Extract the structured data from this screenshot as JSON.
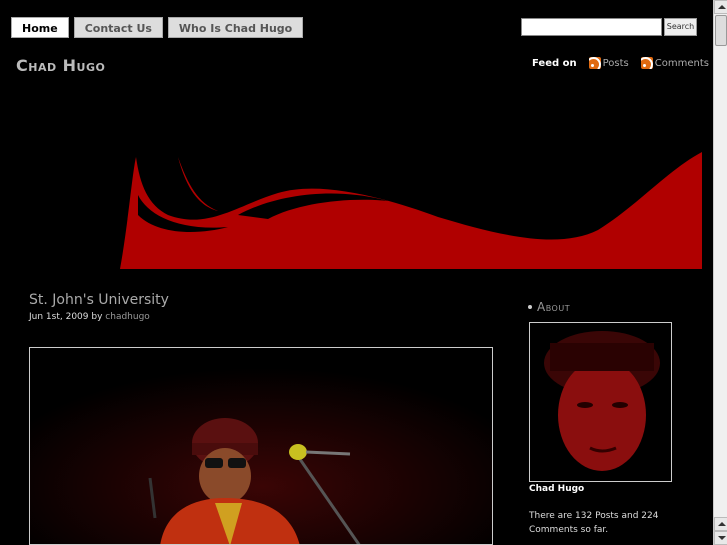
{
  "nav": {
    "items": [
      {
        "label": "Home",
        "active": true
      },
      {
        "label": "Contact Us",
        "active": false
      },
      {
        "label": "Who Is Chad Hugo",
        "active": false
      }
    ]
  },
  "search": {
    "value": "",
    "button_label": "Search"
  },
  "site": {
    "title": "Chad Hugo"
  },
  "feed": {
    "label": "Feed on",
    "posts": "Posts",
    "comments": "Comments",
    "icon": "rss-icon"
  },
  "post": {
    "title": "St. John's University",
    "date": "Jun 1st, 2009",
    "by": "by",
    "author": "chadhugo"
  },
  "sidebar": {
    "heading": "About",
    "name": "Chad Hugo",
    "stats": "There are 132 Posts and 224 Comments so far."
  },
  "colors": {
    "background": "#000000",
    "accent_red": "#b00000",
    "rss_orange": "#e06a10"
  }
}
